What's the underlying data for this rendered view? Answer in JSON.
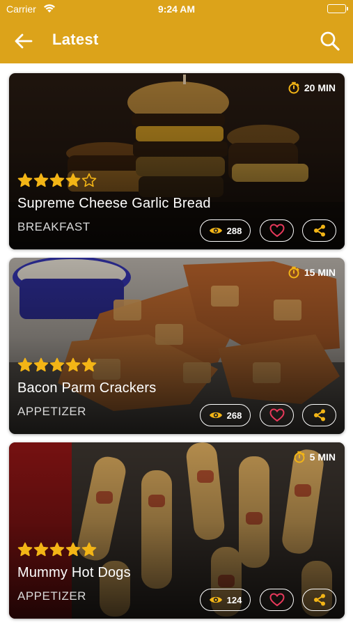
{
  "status_bar": {
    "carrier": "Carrier",
    "time": "9:24 AM"
  },
  "header": {
    "title": "Latest",
    "back_icon": "arrow-left-icon",
    "search_icon": "search-icon"
  },
  "colors": {
    "accent": "#DCA31A",
    "star": "#F3B516",
    "heart": "#E8395B",
    "share": "#F3B516"
  },
  "recipes": [
    {
      "title": "Supreme Cheese Garlic Bread",
      "category": "BREAKFAST",
      "time": "20 MIN",
      "rating": 4,
      "rating_max": 5,
      "views": "288"
    },
    {
      "title": "Bacon Parm Crackers",
      "category": "APPETIZER",
      "time": "15 MIN",
      "rating": 5,
      "rating_max": 5,
      "views": "268"
    },
    {
      "title": "Mummy Hot Dogs",
      "category": "APPETIZER",
      "time": "5 MIN",
      "rating": 5,
      "rating_max": 5,
      "views": "124"
    }
  ]
}
